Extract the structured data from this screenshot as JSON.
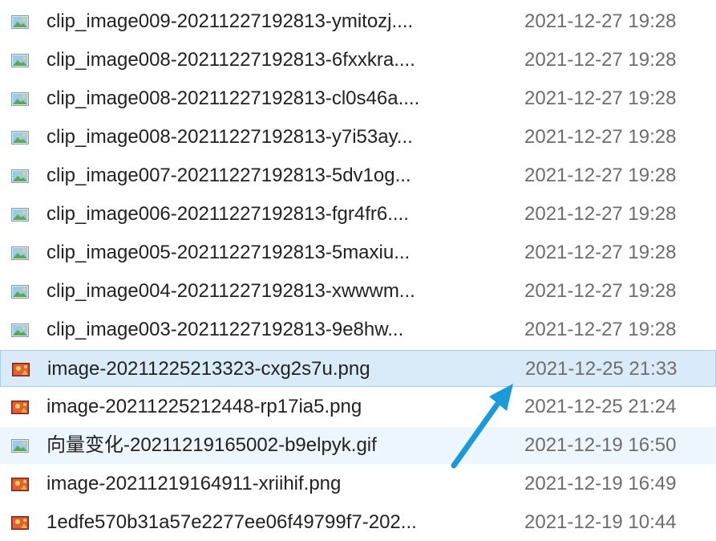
{
  "files": [
    {
      "name": "clip_image009-20211227192813-ymitozj....",
      "date": "2021-12-27 19:28",
      "icon": "image-file-icon",
      "type": "img",
      "state": ""
    },
    {
      "name": "clip_image008-20211227192813-6fxxkra....",
      "date": "2021-12-27 19:28",
      "icon": "image-file-icon",
      "type": "img",
      "state": ""
    },
    {
      "name": "clip_image008-20211227192813-cl0s46a....",
      "date": "2021-12-27 19:28",
      "icon": "image-file-icon",
      "type": "img",
      "state": ""
    },
    {
      "name": "clip_image008-20211227192813-y7i53ay...",
      "date": "2021-12-27 19:28",
      "icon": "image-file-icon",
      "type": "img",
      "state": ""
    },
    {
      "name": "clip_image007-20211227192813-5dv1og...",
      "date": "2021-12-27 19:28",
      "icon": "image-file-icon",
      "type": "img",
      "state": ""
    },
    {
      "name": "clip_image006-20211227192813-fgr4fr6....",
      "date": "2021-12-27 19:28",
      "icon": "image-file-icon",
      "type": "img",
      "state": ""
    },
    {
      "name": "clip_image005-20211227192813-5maxiu...",
      "date": "2021-12-27 19:28",
      "icon": "image-file-icon",
      "type": "img",
      "state": ""
    },
    {
      "name": "clip_image004-20211227192813-xwwwm...",
      "date": "2021-12-27 19:28",
      "icon": "image-file-icon",
      "type": "img",
      "state": ""
    },
    {
      "name": "clip_image003-20211227192813-9e8hw...",
      "date": "2021-12-27 19:28",
      "icon": "image-file-icon",
      "type": "img",
      "state": ""
    },
    {
      "name": "image-20211225213323-cxg2s7u.png",
      "date": "2021-12-25 21:33",
      "icon": "png-file-icon",
      "type": "png",
      "state": "selected"
    },
    {
      "name": "image-20211225212448-rp17ia5.png",
      "date": "2021-12-25 21:24",
      "icon": "png-file-icon",
      "type": "png",
      "state": ""
    },
    {
      "name": "向量变化-20211219165002-b9elpyk.gif",
      "date": "2021-12-19 16:50",
      "icon": "gif-file-icon",
      "type": "img",
      "state": "hover"
    },
    {
      "name": "image-20211219164911-xriihif.png",
      "date": "2021-12-19 16:49",
      "icon": "png-file-icon",
      "type": "png",
      "state": ""
    },
    {
      "name": "1edfe570b31a57e2277ee06f49799f7-202...",
      "date": "2021-12-19 10:44",
      "icon": "png-file-icon",
      "type": "png",
      "state": ""
    }
  ],
  "colors": {
    "selected_bg": "#d9ebf9",
    "hover_bg": "#eef6fd",
    "arrow": "#1a9ad6"
  },
  "annotation": {
    "icon": "arrow-annotation-icon"
  }
}
